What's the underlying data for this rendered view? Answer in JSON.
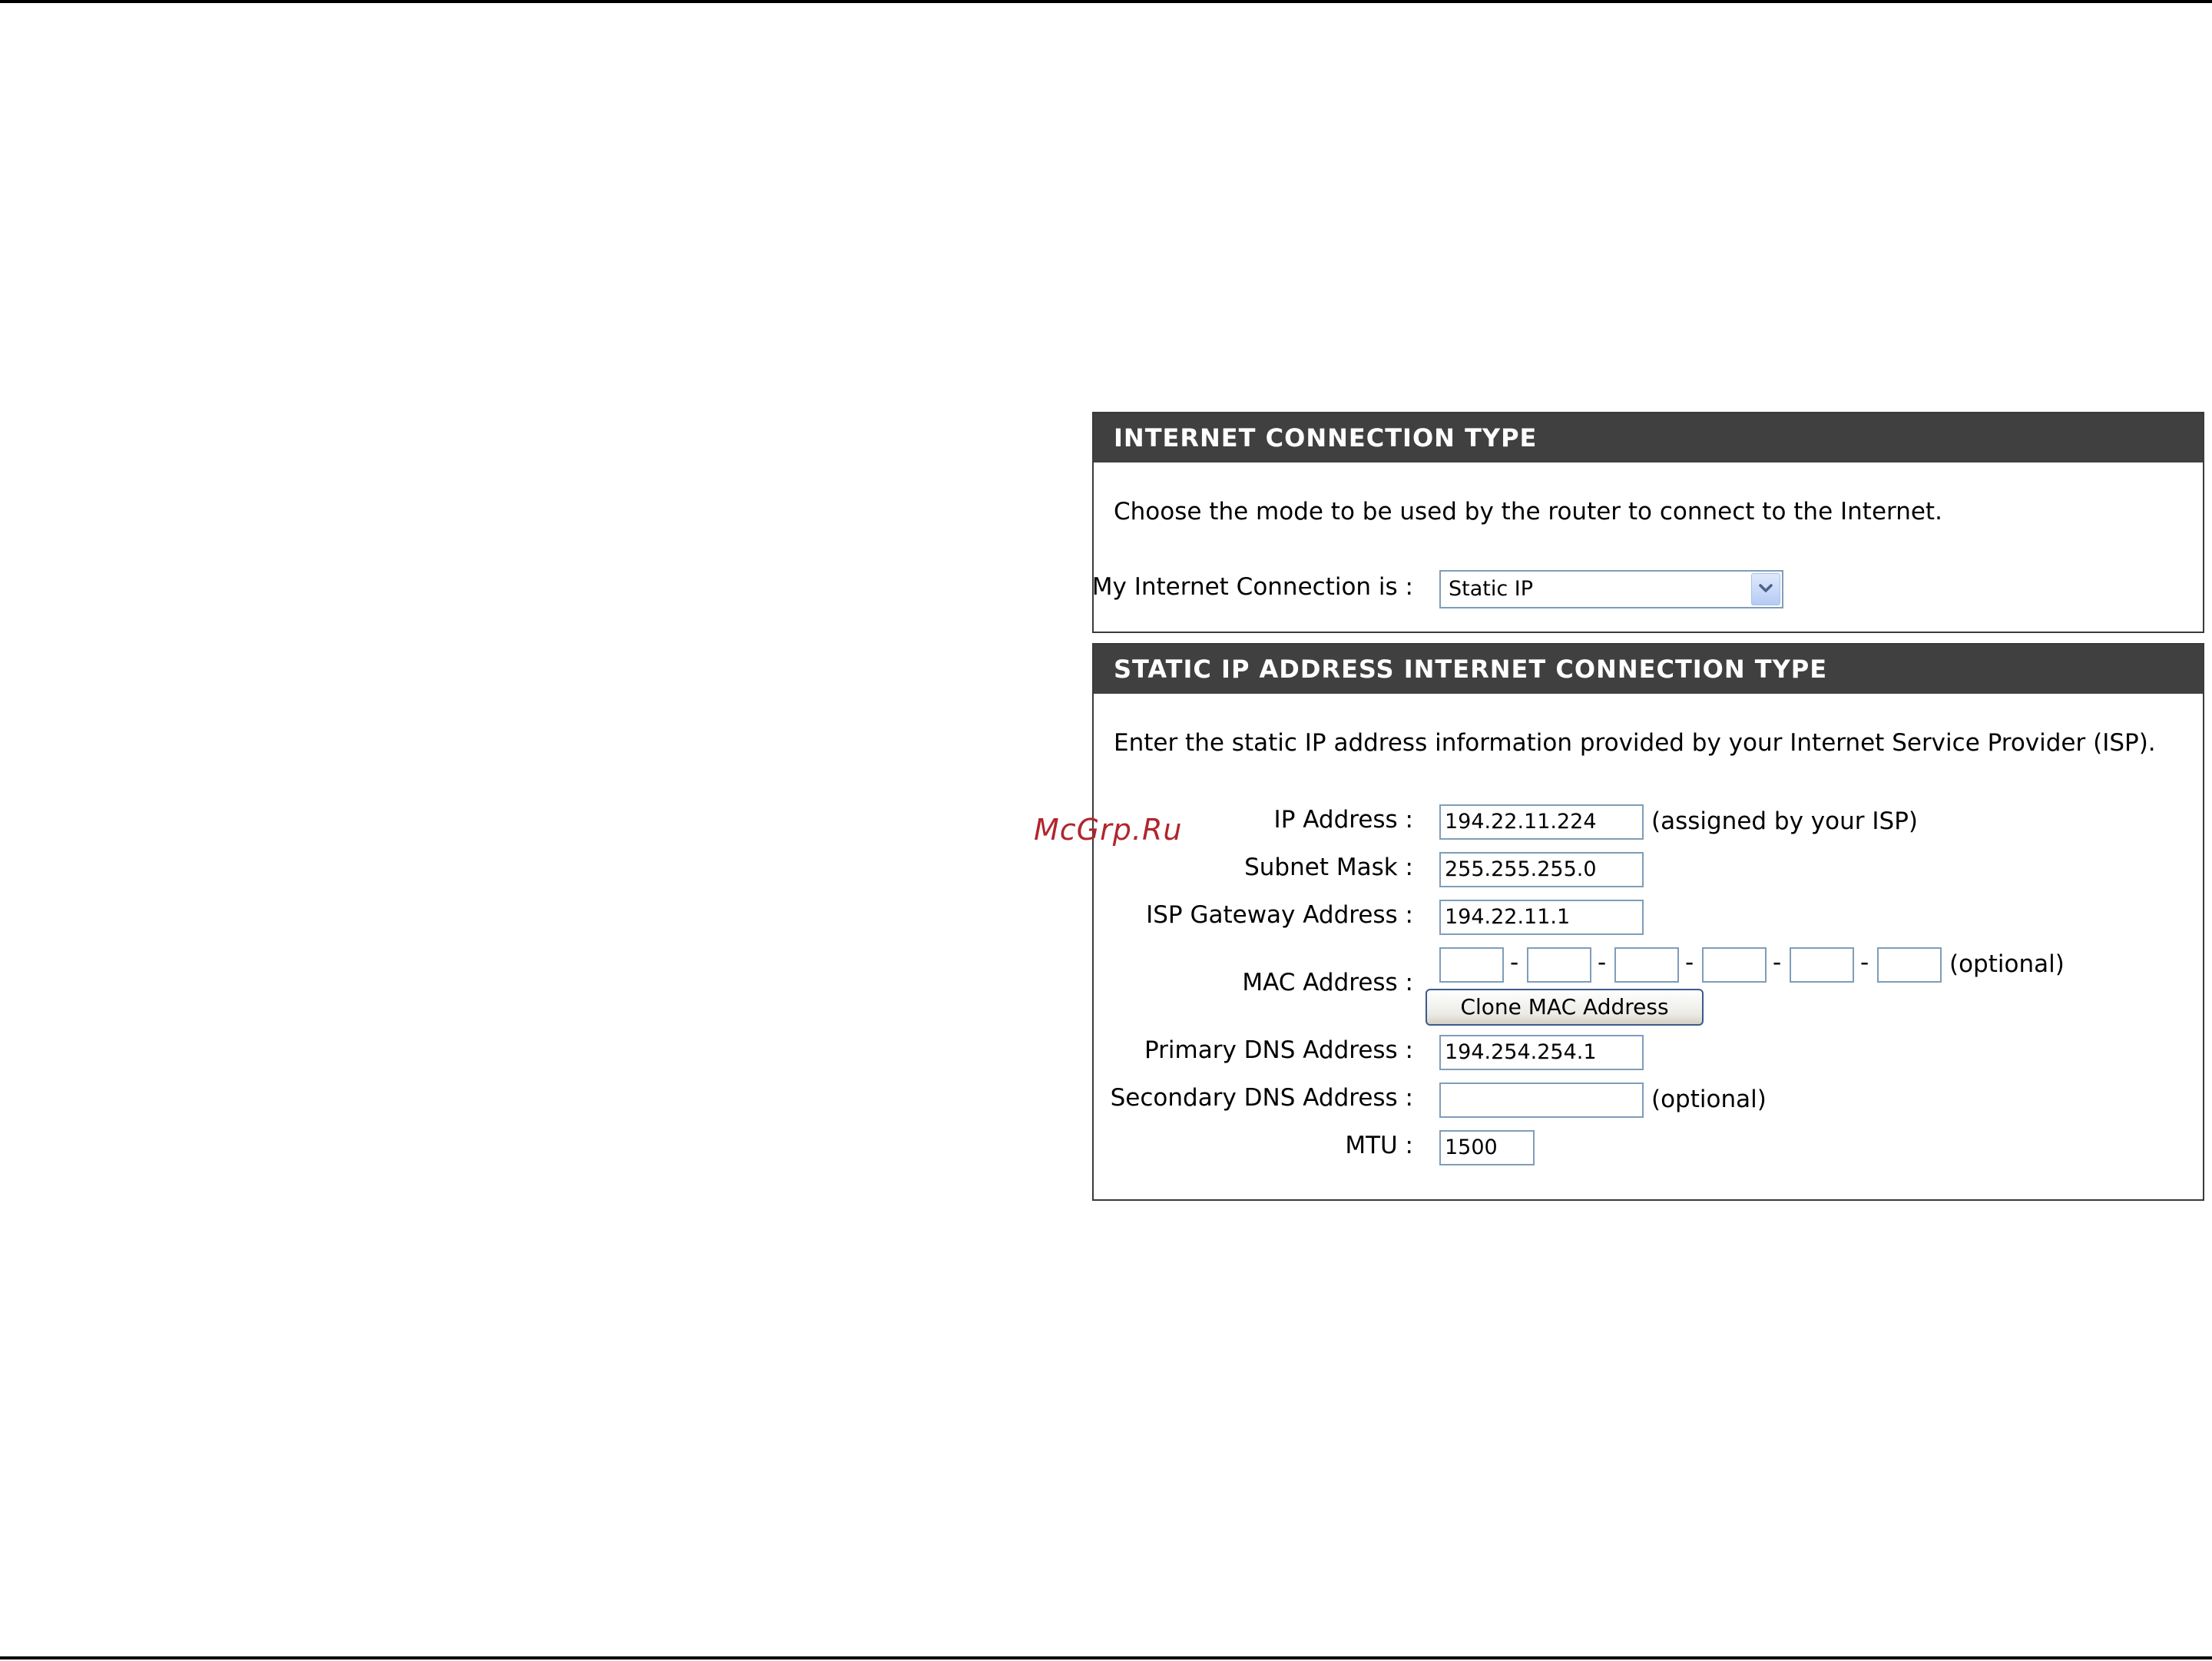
{
  "connection_type_panel": {
    "title": "INTERNET CONNECTION TYPE",
    "intro": "Choose the mode to be used by the router to connect to the Internet.",
    "connection_label": "My Internet Connection is :",
    "connection_selected": "Static IP"
  },
  "static_ip_panel": {
    "title": "STATIC IP ADDRESS INTERNET CONNECTION TYPE",
    "intro": "Enter the static IP address information provided by your Internet Service Provider (ISP).",
    "ip_address": {
      "label": "IP Address :",
      "value": "194.22.11.224",
      "note": "(assigned by your ISP)"
    },
    "subnet_mask": {
      "label": "Subnet Mask :",
      "value": "255.255.255.0"
    },
    "gateway": {
      "label": "ISP Gateway Address :",
      "value": "194.22.11.1"
    },
    "mac": {
      "label": "MAC Address :",
      "octets": [
        "",
        "",
        "",
        "",
        "",
        ""
      ],
      "separator": "-",
      "note": "(optional)",
      "clone_button": "Clone MAC Address"
    },
    "primary_dns": {
      "label": "Primary DNS Address :",
      "value": "194.254.254.1"
    },
    "secondary_dns": {
      "label": "Secondary DNS Address :",
      "value": "",
      "note": "(optional)"
    },
    "mtu": {
      "label": "MTU :",
      "value": "1500"
    }
  },
  "watermark": "McGrp.Ru",
  "icons": {
    "dropdown": "chevron-down-icon"
  }
}
